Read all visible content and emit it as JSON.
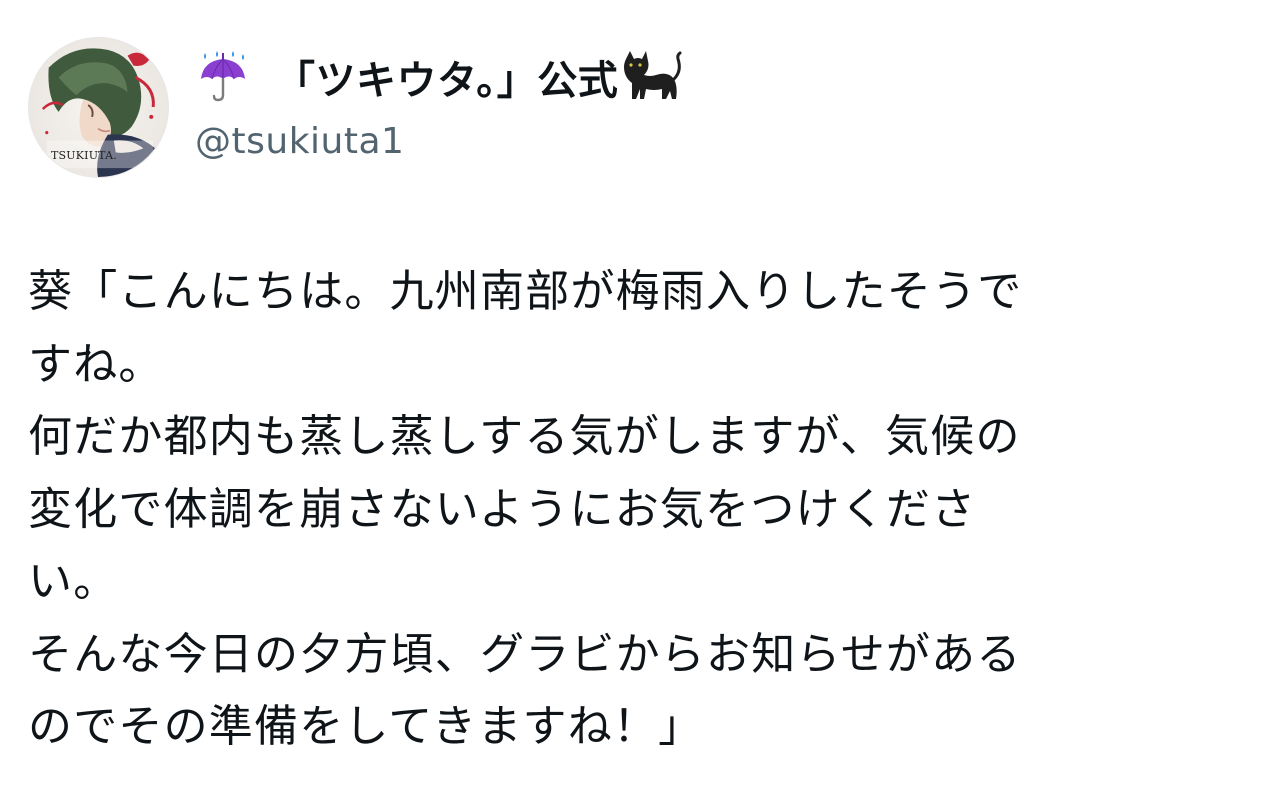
{
  "author": {
    "display_name": "「ツキウタ。」公式",
    "handle": "@tsukiuta1",
    "avatar_caption": "TSUKIUTA.",
    "leading_emoji": "umbrella-with-rain-icon",
    "trailing_emoji": "black-cat-icon"
  },
  "tweet": {
    "lines": [
      "葵「こんにちは。九州南部が梅雨入りしたそうで",
      "すね。",
      "何だか都内も蒸し蒸しする気がしますが、気候の",
      "変化で体調を崩さないようにお気をつけくださ",
      "い。",
      "そんな今日の夕方頃、グラビからお知らせがある",
      "のでその準備をしてきますね！」"
    ]
  },
  "colors": {
    "text": "#0f1419",
    "handle": "#536471",
    "umbrella": "#8a3fd1",
    "rain": "#2d8fe6",
    "background": "#ffffff"
  }
}
